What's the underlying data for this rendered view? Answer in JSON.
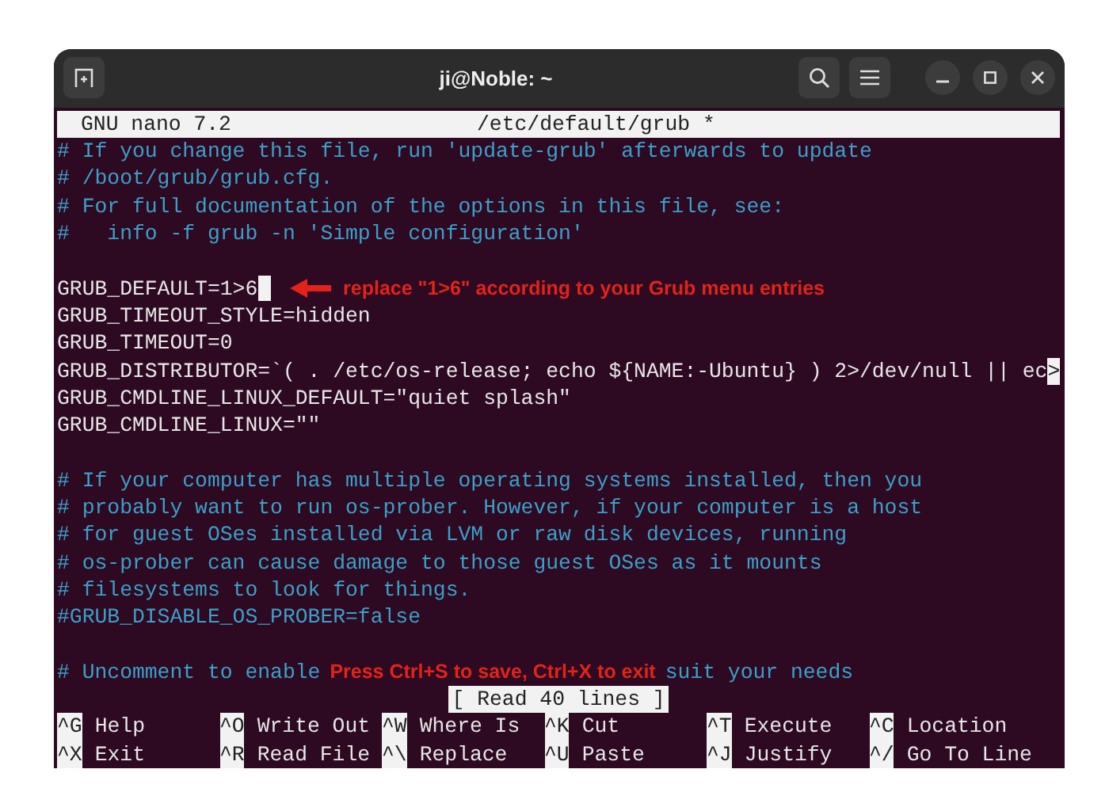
{
  "window": {
    "title": "ji@Noble: ~"
  },
  "nano": {
    "version": "GNU nano 7.2",
    "file": "/etc/default/grub *"
  },
  "lines": [
    {
      "kind": "comment",
      "text": "# If you change this file, run 'update-grub' afterwards to update"
    },
    {
      "kind": "comment",
      "text": "# /boot/grub/grub.cfg."
    },
    {
      "kind": "comment",
      "text": "# For full documentation of the options in this file, see:"
    },
    {
      "kind": "comment",
      "text": "#   info -f grub -n 'Simple configuration'"
    },
    {
      "kind": "blank"
    },
    {
      "kind": "code",
      "text": "GRUB_DEFAULT=1>6",
      "cursor": true,
      "annotation": {
        "text": "replace \"1>6\" according to your Grub menu entries",
        "arrow": true
      }
    },
    {
      "kind": "code",
      "text": "GRUB_TIMEOUT_STYLE=hidden"
    },
    {
      "kind": "code",
      "text": "GRUB_TIMEOUT=0"
    },
    {
      "kind": "code",
      "text": "GRUB_DISTRIBUTOR=`( . /etc/os-release; echo ${NAME:-Ubuntu} ) 2>/dev/null || ec",
      "overflow": ">"
    },
    {
      "kind": "code",
      "text": "GRUB_CMDLINE_LINUX_DEFAULT=\"quiet splash\""
    },
    {
      "kind": "code",
      "text": "GRUB_CMDLINE_LINUX=\"\""
    },
    {
      "kind": "blank"
    },
    {
      "kind": "comment",
      "text": "# If your computer has multiple operating systems installed, then you"
    },
    {
      "kind": "comment",
      "text": "# probably want to run os-prober. However, if your computer is a host"
    },
    {
      "kind": "comment",
      "text": "# for guest OSes installed via LVM or raw disk devices, running"
    },
    {
      "kind": "comment",
      "text": "# os-prober can cause damage to those guest OSes as it mounts"
    },
    {
      "kind": "comment",
      "text": "# filesystems to look for things."
    },
    {
      "kind": "comment",
      "text": "#GRUB_DISABLE_OS_PROBER=false"
    },
    {
      "kind": "blank"
    },
    {
      "kind": "comment",
      "text": "# Uncomment to enable",
      "annotation": {
        "text": "Press Ctrl+S to save, Ctrl+X to exit",
        "arrow": false
      },
      "text_after": "suit your needs"
    }
  ],
  "status": "[ Read 40 lines ]",
  "shortcuts": [
    {
      "key": "^G",
      "label": "Help"
    },
    {
      "key": "^O",
      "label": "Write Out"
    },
    {
      "key": "^W",
      "label": "Where Is"
    },
    {
      "key": "^K",
      "label": "Cut"
    },
    {
      "key": "^T",
      "label": "Execute"
    },
    {
      "key": "^C",
      "label": "Location"
    },
    {
      "key": "^X",
      "label": "Exit"
    },
    {
      "key": "^R",
      "label": "Read File"
    },
    {
      "key": "^\\",
      "label": "Replace"
    },
    {
      "key": "^U",
      "label": "Paste"
    },
    {
      "key": "^J",
      "label": "Justify"
    },
    {
      "key": "^/",
      "label": "Go To Line"
    }
  ]
}
